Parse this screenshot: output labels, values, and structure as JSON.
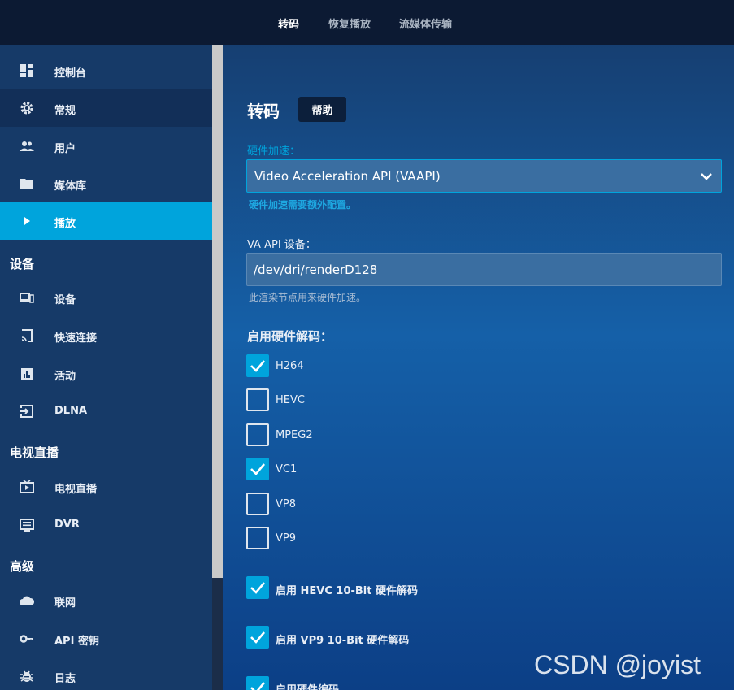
{
  "top_tabs": [
    {
      "label": "转码",
      "active": true
    },
    {
      "label": "恢复播放",
      "active": false
    },
    {
      "label": "流媒体传输",
      "active": false
    }
  ],
  "sidebar": {
    "items": [
      {
        "label": "控制台",
        "icon": "dashboard-icon"
      },
      {
        "label": "常规",
        "icon": "gear-icon"
      },
      {
        "label": "用户",
        "icon": "users-icon"
      },
      {
        "label": "媒体库",
        "icon": "folder-icon"
      },
      {
        "label": "播放",
        "icon": "play-icon"
      }
    ],
    "sections": [
      {
        "title": "设备",
        "items": [
          {
            "label": "设备",
            "icon": "devices-icon"
          },
          {
            "label": "快速连接",
            "icon": "cast-icon"
          },
          {
            "label": "活动",
            "icon": "activity-chart-icon"
          },
          {
            "label": "DLNA",
            "icon": "input-icon"
          }
        ]
      },
      {
        "title": "电视直播",
        "items": [
          {
            "label": "电视直播",
            "icon": "live-tv-icon"
          },
          {
            "label": "DVR",
            "icon": "dvr-icon"
          }
        ]
      },
      {
        "title": "高级",
        "items": [
          {
            "label": "联网",
            "icon": "cloud-icon"
          },
          {
            "label": "API 密钥",
            "icon": "key-icon"
          },
          {
            "label": "日志",
            "icon": "bug-icon"
          }
        ]
      }
    ]
  },
  "main": {
    "title": "转码",
    "help_label": "帮助",
    "hw_accel_label": "硬件加速：",
    "hw_accel_value": "Video Acceleration API (VAAPI)",
    "hw_accel_hint": "硬件加速需要额外配置。",
    "va_device_label": "VA API 设备：",
    "va_device_value": "/dev/dri/renderD128",
    "va_device_hint": "此渲染节点用来硬件加速。",
    "decode_title": "启用硬件解码：",
    "codecs": [
      {
        "label": "H264",
        "checked": true
      },
      {
        "label": "HEVC",
        "checked": false
      },
      {
        "label": "MPEG2",
        "checked": false
      },
      {
        "label": "VC1",
        "checked": true
      },
      {
        "label": "VP8",
        "checked": false
      },
      {
        "label": "VP9",
        "checked": false
      }
    ],
    "options": [
      {
        "label": "启用 HEVC 10-Bit 硬件解码",
        "checked": true
      },
      {
        "label": "启用 VP9 10-Bit 硬件解码",
        "checked": true
      },
      {
        "label": "启用硬件编码",
        "checked": true
      }
    ]
  },
  "colors": {
    "accent": "#00a4dc",
    "sidebar": "#163a68",
    "topbar": "#0c1a33"
  },
  "watermark": "CSDN @joyist"
}
